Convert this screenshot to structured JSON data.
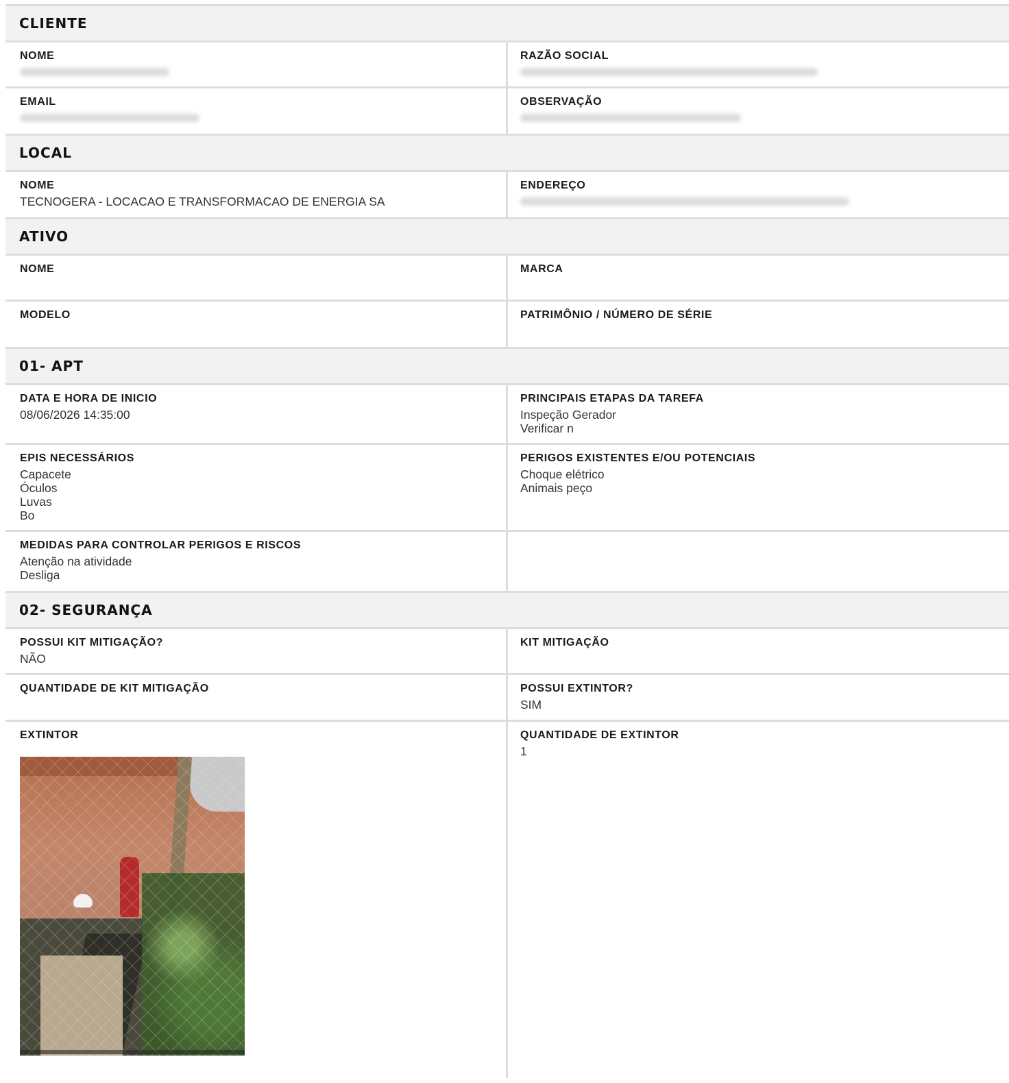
{
  "cliente": {
    "header": "CLIENTE",
    "nome_label": "NOME",
    "razao_label": "RAZÃO SOCIAL",
    "email_label": "EMAIL",
    "observacao_label": "OBSERVAÇÃO"
  },
  "local": {
    "header": "LOCAL",
    "nome_label": "NOME",
    "nome_value": "TECNOGERA - LOCACAO E TRANSFORMACAO DE ENERGIA SA",
    "endereco_label": "ENDEREÇO"
  },
  "ativo": {
    "header": "ATIVO",
    "nome_label": "NOME",
    "marca_label": "MARCA",
    "modelo_label": "MODELO",
    "patrimonio_label": "PATRIMÔNIO / NÚMERO DE SÉRIE"
  },
  "apt": {
    "header": "01- APT",
    "inicio_label": "DATA E HORA DE INICIO",
    "inicio_value": "08/06/2026 14:35:00",
    "etapas_label": "PRINCIPAIS ETAPAS DA TAREFA",
    "etapas_value": "Inspeção Gerador\nVerificar n",
    "epis_label": "EPIS NECESSÁRIOS",
    "epis_value": "Capacete\nÓculos\nLuvas\nBo",
    "perigos_label": "PERIGOS EXISTENTES E/OU POTENCIAIS",
    "perigos_value": "Choque elétrico\nAnimais peço",
    "medidas_label": "MEDIDAS PARA CONTROLAR PERIGOS E RISCOS",
    "medidas_value": "Atenção na atividade\nDesliga"
  },
  "seguranca": {
    "header": "02- SEGURANÇA",
    "possui_kit_label": "POSSUI KIT MITIGAÇÃO?",
    "possui_kit_value": "NÃO",
    "kit_label": "KIT MITIGAÇÃO",
    "qtd_kit_label": "QUANTIDADE DE KIT MITIGAÇÃO",
    "possui_extintor_label": "POSSUI EXTINTOR?",
    "possui_extintor_value": "SIM",
    "extintor_label": "EXTINTOR",
    "qtd_extintor_label": "QUANTIDADE DE EXTINTOR",
    "qtd_extintor_value": "1"
  }
}
